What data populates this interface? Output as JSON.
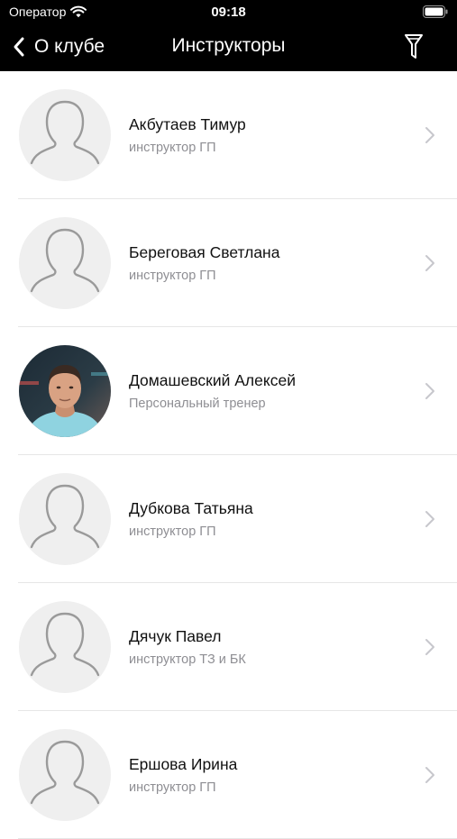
{
  "status_bar": {
    "carrier": "Оператор",
    "time": "09:18"
  },
  "nav": {
    "back_label": "О клубе",
    "title": "Инструкторы"
  },
  "instructors": [
    {
      "name": "Акбутаев Тимур",
      "role": "инструктор ГП",
      "photo": false
    },
    {
      "name": "Береговая Светлана",
      "role": "инструктор ГП",
      "photo": false
    },
    {
      "name": "Домашевский Алексей",
      "role": "Персональный тренер",
      "photo": true
    },
    {
      "name": "Дубкова Татьяна",
      "role": "инструктор ГП",
      "photo": false
    },
    {
      "name": "Дячук Павел",
      "role": "инструктор ТЗ и БК",
      "photo": false
    },
    {
      "name": "Ершова Ирина",
      "role": "инструктор ГП",
      "photo": false
    }
  ],
  "icons": {
    "back": "chevron-left-icon",
    "filter": "filter-icon",
    "row_disclosure": "chevron-right-icon",
    "placeholder_avatar": "person-silhouette-icon"
  },
  "colors": {
    "topbar_bg": "#000000",
    "text_primary": "#111111",
    "text_secondary": "#8e8e93",
    "separator": "#e6e6e6",
    "avatar_placeholder_bg": "#efefef"
  }
}
